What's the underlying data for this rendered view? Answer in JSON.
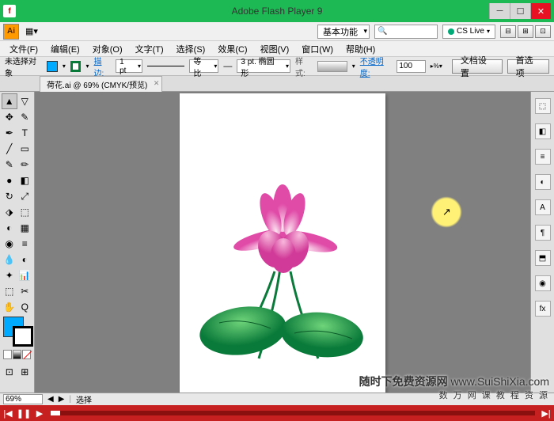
{
  "titlebar": {
    "app": "Adobe Flash Player 9"
  },
  "aibar": {
    "logo": "Ai",
    "workspace": "基本功能",
    "cslive": "CS Live"
  },
  "menu": [
    "文件(F)",
    "编辑(E)",
    "对象(O)",
    "文字(T)",
    "选择(S)",
    "效果(C)",
    "视图(V)",
    "窗口(W)",
    "帮助(H)"
  ],
  "options": {
    "noSelection": "未选择对象",
    "strokeLabel": "描边:",
    "strokeWeight": "1 pt",
    "profile": "等比",
    "brushSize": "3 pt. 椭圆形",
    "styleLabel": "样式:",
    "opacityLabel": "不透明度:",
    "opacityVal": "100",
    "docSetup": "文档设置",
    "prefs": "首选项"
  },
  "tab": {
    "name": "荷花.ai @ 69% (CMYK/预览)"
  },
  "status": {
    "zoom": "69%",
    "tool": "选择"
  },
  "watermark": {
    "line1a": "随时下免费资源网",
    "line1b": "www.SuiShiXia.com",
    "line2": "数 万 网 课 教 程 资 源"
  },
  "toolIcons": [
    "▲",
    "▽",
    "✥",
    "✎",
    "T",
    "╱",
    "▭",
    "✎",
    "✂",
    "↻",
    "◐",
    "▦",
    "◉",
    "≡",
    "◧",
    "⬚",
    "⊞",
    "⬒",
    "✋",
    "⊕",
    "▢",
    "Q"
  ],
  "panelIcons": [
    "⬚",
    "◧",
    "≡",
    "◐",
    "A",
    "¶",
    "⬒",
    "◉",
    "fx"
  ]
}
